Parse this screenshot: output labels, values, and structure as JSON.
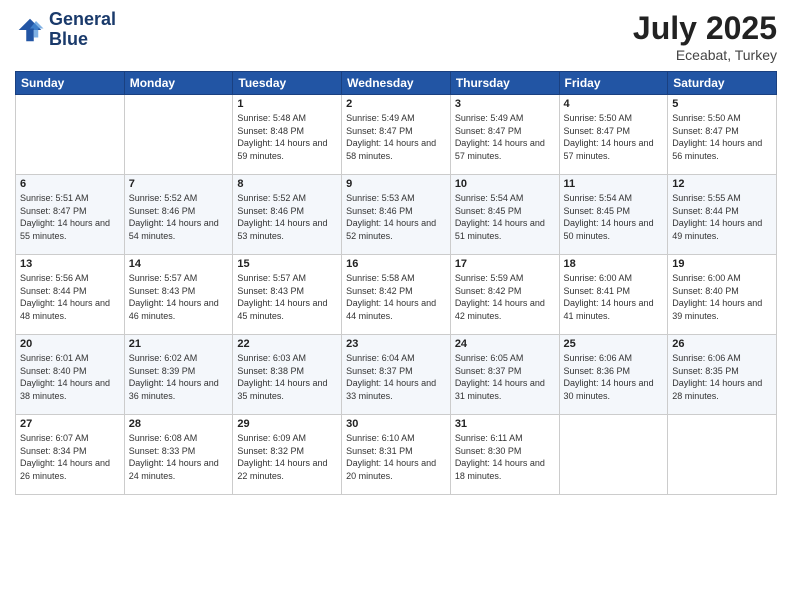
{
  "logo": {
    "line1": "General",
    "line2": "Blue"
  },
  "title": "July 2025",
  "location": "Eceabat, Turkey",
  "headers": [
    "Sunday",
    "Monday",
    "Tuesday",
    "Wednesday",
    "Thursday",
    "Friday",
    "Saturday"
  ],
  "weeks": [
    [
      {
        "day": "",
        "sunrise": "",
        "sunset": "",
        "daylight": ""
      },
      {
        "day": "",
        "sunrise": "",
        "sunset": "",
        "daylight": ""
      },
      {
        "day": "1",
        "sunrise": "Sunrise: 5:48 AM",
        "sunset": "Sunset: 8:48 PM",
        "daylight": "Daylight: 14 hours and 59 minutes."
      },
      {
        "day": "2",
        "sunrise": "Sunrise: 5:49 AM",
        "sunset": "Sunset: 8:47 PM",
        "daylight": "Daylight: 14 hours and 58 minutes."
      },
      {
        "day": "3",
        "sunrise": "Sunrise: 5:49 AM",
        "sunset": "Sunset: 8:47 PM",
        "daylight": "Daylight: 14 hours and 57 minutes."
      },
      {
        "day": "4",
        "sunrise": "Sunrise: 5:50 AM",
        "sunset": "Sunset: 8:47 PM",
        "daylight": "Daylight: 14 hours and 57 minutes."
      },
      {
        "day": "5",
        "sunrise": "Sunrise: 5:50 AM",
        "sunset": "Sunset: 8:47 PM",
        "daylight": "Daylight: 14 hours and 56 minutes."
      }
    ],
    [
      {
        "day": "6",
        "sunrise": "Sunrise: 5:51 AM",
        "sunset": "Sunset: 8:47 PM",
        "daylight": "Daylight: 14 hours and 55 minutes."
      },
      {
        "day": "7",
        "sunrise": "Sunrise: 5:52 AM",
        "sunset": "Sunset: 8:46 PM",
        "daylight": "Daylight: 14 hours and 54 minutes."
      },
      {
        "day": "8",
        "sunrise": "Sunrise: 5:52 AM",
        "sunset": "Sunset: 8:46 PM",
        "daylight": "Daylight: 14 hours and 53 minutes."
      },
      {
        "day": "9",
        "sunrise": "Sunrise: 5:53 AM",
        "sunset": "Sunset: 8:46 PM",
        "daylight": "Daylight: 14 hours and 52 minutes."
      },
      {
        "day": "10",
        "sunrise": "Sunrise: 5:54 AM",
        "sunset": "Sunset: 8:45 PM",
        "daylight": "Daylight: 14 hours and 51 minutes."
      },
      {
        "day": "11",
        "sunrise": "Sunrise: 5:54 AM",
        "sunset": "Sunset: 8:45 PM",
        "daylight": "Daylight: 14 hours and 50 minutes."
      },
      {
        "day": "12",
        "sunrise": "Sunrise: 5:55 AM",
        "sunset": "Sunset: 8:44 PM",
        "daylight": "Daylight: 14 hours and 49 minutes."
      }
    ],
    [
      {
        "day": "13",
        "sunrise": "Sunrise: 5:56 AM",
        "sunset": "Sunset: 8:44 PM",
        "daylight": "Daylight: 14 hours and 48 minutes."
      },
      {
        "day": "14",
        "sunrise": "Sunrise: 5:57 AM",
        "sunset": "Sunset: 8:43 PM",
        "daylight": "Daylight: 14 hours and 46 minutes."
      },
      {
        "day": "15",
        "sunrise": "Sunrise: 5:57 AM",
        "sunset": "Sunset: 8:43 PM",
        "daylight": "Daylight: 14 hours and 45 minutes."
      },
      {
        "day": "16",
        "sunrise": "Sunrise: 5:58 AM",
        "sunset": "Sunset: 8:42 PM",
        "daylight": "Daylight: 14 hours and 44 minutes."
      },
      {
        "day": "17",
        "sunrise": "Sunrise: 5:59 AM",
        "sunset": "Sunset: 8:42 PM",
        "daylight": "Daylight: 14 hours and 42 minutes."
      },
      {
        "day": "18",
        "sunrise": "Sunrise: 6:00 AM",
        "sunset": "Sunset: 8:41 PM",
        "daylight": "Daylight: 14 hours and 41 minutes."
      },
      {
        "day": "19",
        "sunrise": "Sunrise: 6:00 AM",
        "sunset": "Sunset: 8:40 PM",
        "daylight": "Daylight: 14 hours and 39 minutes."
      }
    ],
    [
      {
        "day": "20",
        "sunrise": "Sunrise: 6:01 AM",
        "sunset": "Sunset: 8:40 PM",
        "daylight": "Daylight: 14 hours and 38 minutes."
      },
      {
        "day": "21",
        "sunrise": "Sunrise: 6:02 AM",
        "sunset": "Sunset: 8:39 PM",
        "daylight": "Daylight: 14 hours and 36 minutes."
      },
      {
        "day": "22",
        "sunrise": "Sunrise: 6:03 AM",
        "sunset": "Sunset: 8:38 PM",
        "daylight": "Daylight: 14 hours and 35 minutes."
      },
      {
        "day": "23",
        "sunrise": "Sunrise: 6:04 AM",
        "sunset": "Sunset: 8:37 PM",
        "daylight": "Daylight: 14 hours and 33 minutes."
      },
      {
        "day": "24",
        "sunrise": "Sunrise: 6:05 AM",
        "sunset": "Sunset: 8:37 PM",
        "daylight": "Daylight: 14 hours and 31 minutes."
      },
      {
        "day": "25",
        "sunrise": "Sunrise: 6:06 AM",
        "sunset": "Sunset: 8:36 PM",
        "daylight": "Daylight: 14 hours and 30 minutes."
      },
      {
        "day": "26",
        "sunrise": "Sunrise: 6:06 AM",
        "sunset": "Sunset: 8:35 PM",
        "daylight": "Daylight: 14 hours and 28 minutes."
      }
    ],
    [
      {
        "day": "27",
        "sunrise": "Sunrise: 6:07 AM",
        "sunset": "Sunset: 8:34 PM",
        "daylight": "Daylight: 14 hours and 26 minutes."
      },
      {
        "day": "28",
        "sunrise": "Sunrise: 6:08 AM",
        "sunset": "Sunset: 8:33 PM",
        "daylight": "Daylight: 14 hours and 24 minutes."
      },
      {
        "day": "29",
        "sunrise": "Sunrise: 6:09 AM",
        "sunset": "Sunset: 8:32 PM",
        "daylight": "Daylight: 14 hours and 22 minutes."
      },
      {
        "day": "30",
        "sunrise": "Sunrise: 6:10 AM",
        "sunset": "Sunset: 8:31 PM",
        "daylight": "Daylight: 14 hours and 20 minutes."
      },
      {
        "day": "31",
        "sunrise": "Sunrise: 6:11 AM",
        "sunset": "Sunset: 8:30 PM",
        "daylight": "Daylight: 14 hours and 18 minutes."
      },
      {
        "day": "",
        "sunrise": "",
        "sunset": "",
        "daylight": ""
      },
      {
        "day": "",
        "sunrise": "",
        "sunset": "",
        "daylight": ""
      }
    ]
  ]
}
